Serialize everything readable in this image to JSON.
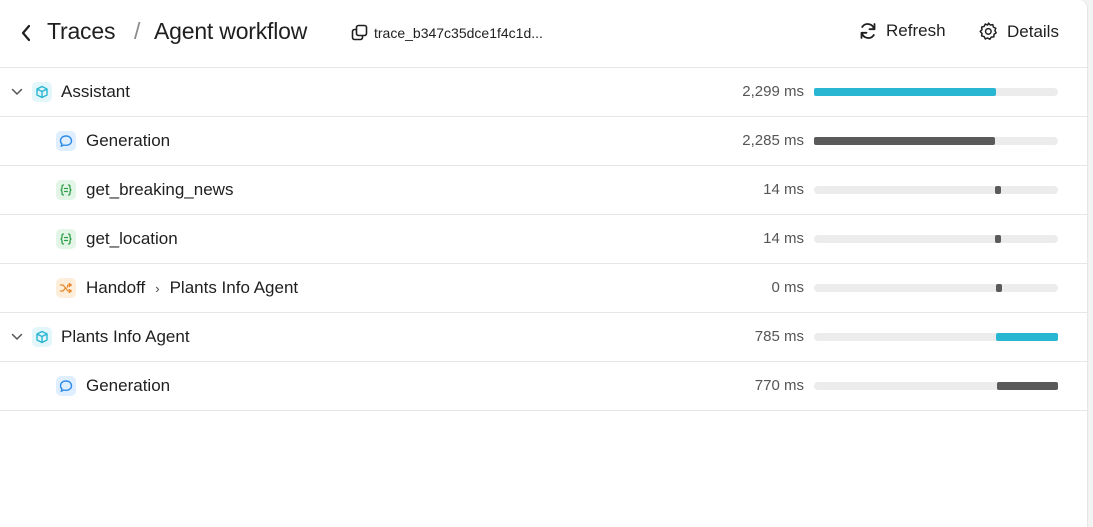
{
  "header": {
    "back_icon": "chevron-left-icon",
    "breadcrumb_root": "Traces",
    "breadcrumb_separator": "/",
    "breadcrumb_current": "Agent workflow",
    "trace_id": "trace_b347c35dce1f4c1d...",
    "copy_icon": "copy-icon",
    "refresh_label": "Refresh",
    "refresh_icon": "refresh-icon",
    "details_label": "Details",
    "details_icon": "gear-icon"
  },
  "colors": {
    "agent_bar": "#29b6d2",
    "span_bar": "#5a5a5a",
    "track": "#ececec",
    "agent_icon": "#29b6d2",
    "generation_icon": "#2f8be6",
    "function_icon": "#2e9e47",
    "handoff_icon": "#e8882a"
  },
  "spans": [
    {
      "label": "Assistant",
      "type": "agent",
      "icon": "cube-icon",
      "expanded": true,
      "duration": "2,299 ms",
      "timeline_start": 0.0,
      "timeline_fraction": 0.746
    },
    {
      "label": "Generation",
      "type": "generation",
      "icon": "chat-bubble-icon",
      "duration": "2,285 ms",
      "timeline_start": 0.0,
      "timeline_fraction": 0.742
    },
    {
      "label": "get_breaking_news",
      "type": "function",
      "icon": "function-icon",
      "duration": "14 ms",
      "timeline_start": 0.742,
      "timeline_fraction": 0.025
    },
    {
      "label": "get_location",
      "type": "function",
      "icon": "function-icon",
      "duration": "14 ms",
      "timeline_start": 0.742,
      "timeline_fraction": 0.025
    },
    {
      "label": "Handoff",
      "target": "Plants Info Agent",
      "type": "handoff",
      "icon": "shuffle-icon",
      "duration": "0 ms",
      "timeline_start": 0.746,
      "timeline_fraction": 0.02
    },
    {
      "label": "Plants Info Agent",
      "type": "agent",
      "icon": "cube-icon",
      "expanded": true,
      "duration": "785 ms",
      "timeline_start": 0.746,
      "timeline_fraction": 0.254
    },
    {
      "label": "Generation",
      "type": "generation",
      "icon": "chat-bubble-icon",
      "duration": "770 ms",
      "timeline_start": 0.75,
      "timeline_fraction": 0.25
    }
  ]
}
